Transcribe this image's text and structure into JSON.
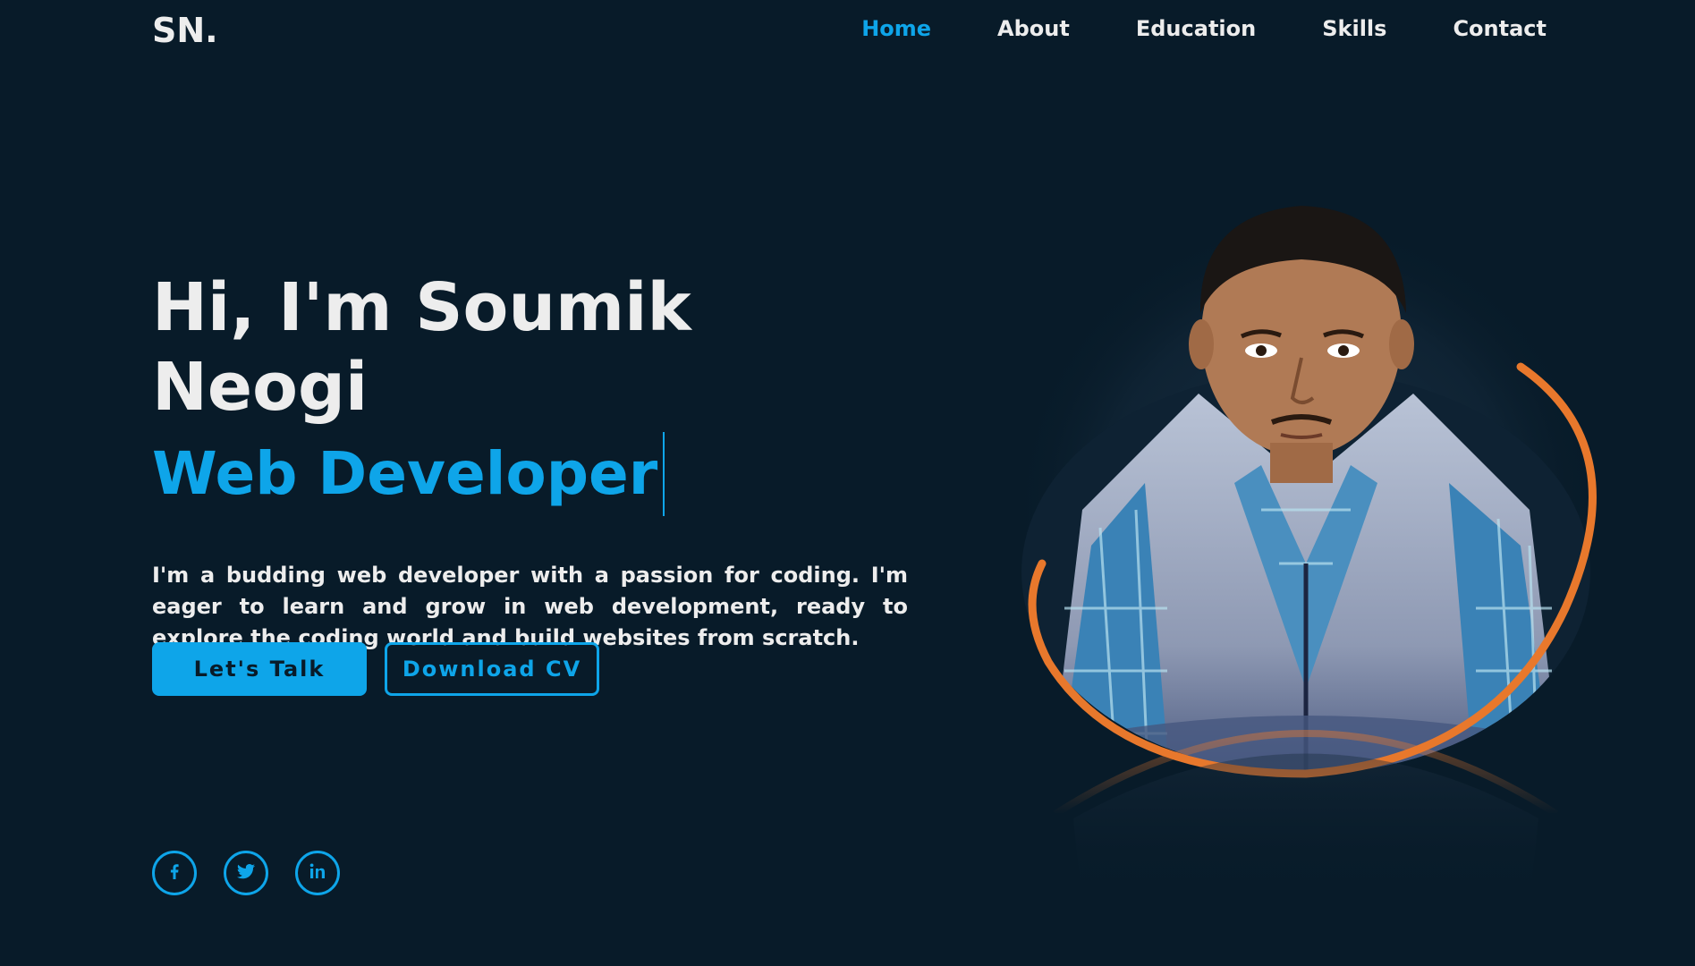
{
  "header": {
    "logo": "SN.",
    "nav": [
      {
        "label": "Home",
        "active": true
      },
      {
        "label": "About",
        "active": false
      },
      {
        "label": "Education",
        "active": false
      },
      {
        "label": "Skills",
        "active": false
      },
      {
        "label": "Contact",
        "active": false
      }
    ]
  },
  "hero": {
    "greeting": "Hi, I'm Soumik Neogi",
    "role": "Web Developer",
    "description": "I'm a budding web developer with a passion for coding. I'm eager to learn and grow in web development, ready to explore the coding world and build websites from scratch."
  },
  "buttons": {
    "talk_label": "Let's Talk",
    "cv_label": "Download CV"
  },
  "socials": [
    {
      "icon": "facebook-icon"
    },
    {
      "icon": "twitter-icon"
    },
    {
      "icon": "linkedin-icon"
    }
  ],
  "colors": {
    "background": "#081b29",
    "accent": "#0ea5e9",
    "ring": "#e8782c",
    "text": "#ededed"
  }
}
